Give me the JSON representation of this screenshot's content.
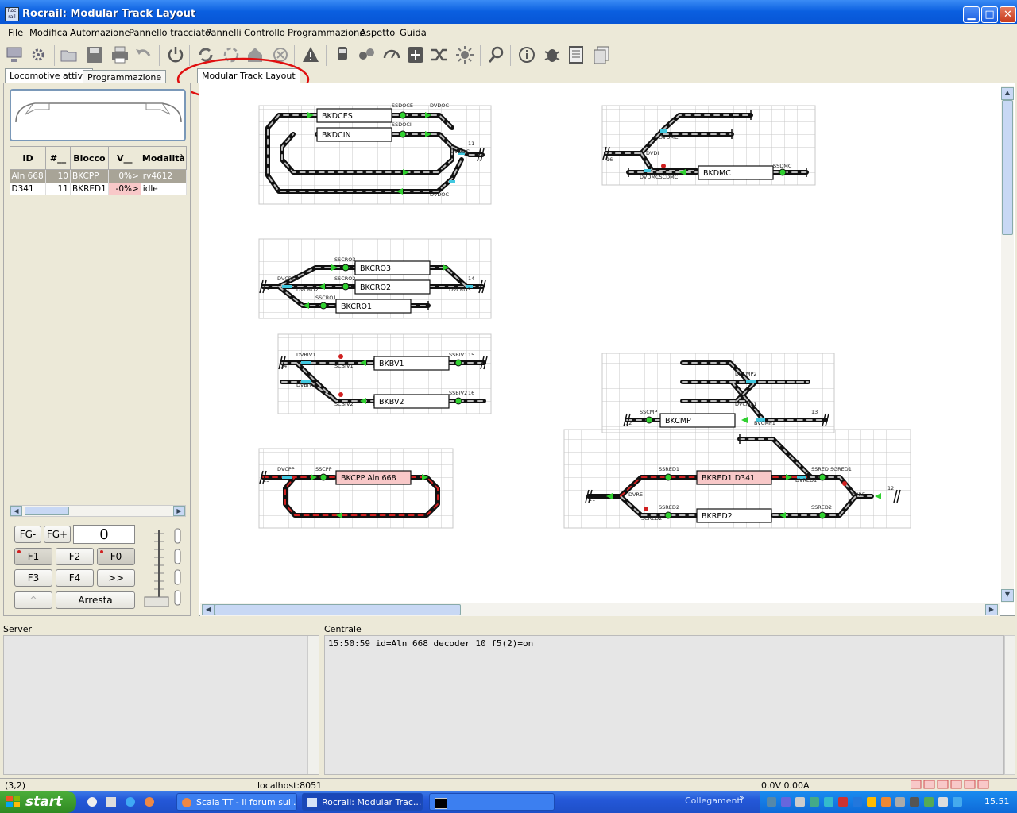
{
  "window": {
    "title": "Rocrail: Modular Track Layout",
    "icon_label": "Roc rail"
  },
  "menu": [
    "File",
    "Modifica",
    "Automazione",
    "Pannello tracciato",
    "Pannelli",
    "Controllo",
    "Programmazione",
    "Aspetto",
    "Guida"
  ],
  "toolbar_icons": [
    "network-icon",
    "gear-icon",
    "folder-open-icon",
    "save-icon",
    "print-icon",
    "undo-icon",
    "power-icon",
    "refresh-icon",
    "cycle-icon",
    "house-icon",
    "cancel-icon",
    "warning-icon",
    "locomotive-icon",
    "railcar-icon",
    "speedometer-icon",
    "switchbox-icon",
    "shuffle-icon",
    "light-icon",
    "zoom-icon",
    "info-icon",
    "bug-icon",
    "document-icon",
    "copy-icon"
  ],
  "left_tabs": [
    "Locomotive attive",
    "Programmazione"
  ],
  "plan_tab": "Modular Track Layout",
  "loco_table": {
    "headers": [
      "ID",
      "#__",
      "Blocco",
      "V__",
      "Modalità"
    ],
    "rows": [
      {
        "id": "Aln 668",
        "addr": "10",
        "block": "BKCPP",
        "speed": "0%>",
        "mode": "rv4612"
      },
      {
        "id": "D341",
        "addr": "11",
        "block": "BKRED1",
        "speed": "-0%>",
        "mode": "idle"
      }
    ]
  },
  "throttle": {
    "fg_minus": "FG-",
    "fg_plus": "FG+",
    "speed": "0",
    "f1": "F1",
    "f2": "F2",
    "f0": "F0",
    "f3": "F3",
    "f4": "F4",
    "more": ">>",
    "up": "^",
    "stop": "Arresta"
  },
  "plan": {
    "blocks": [
      {
        "label": "BKDCES",
        "state": "free"
      },
      {
        "label": "BKDCIN",
        "state": "free"
      },
      {
        "label": "BKDMC",
        "state": "free"
      },
      {
        "label": "BKCRO3",
        "state": "free"
      },
      {
        "label": "BKCRO2",
        "state": "free"
      },
      {
        "label": "BKCRO1",
        "state": "free"
      },
      {
        "label": "BKBV1",
        "state": "free"
      },
      {
        "label": "BKBV2",
        "state": "free"
      },
      {
        "label": "BKCMP",
        "state": "free"
      },
      {
        "label": "BKCPP Aln 668",
        "state": "occupied"
      },
      {
        "label": "BKRED1 D341",
        "state": "occupied"
      },
      {
        "label": "BKRED2",
        "state": "free"
      }
    ],
    "labels": [
      "SSDOCE",
      "SSDOCI",
      "DVDOC",
      "DVDOC",
      "DVDOC",
      "11",
      "DVDMC",
      "DVDI",
      "16",
      "DVDMCSCDMC",
      "SSDMC",
      "SSCRO3",
      "SSCRO2",
      "SSCRO1",
      "DVCRO1",
      "DVCRO2",
      "DVCRO3",
      "13",
      "14",
      "DVBIV1",
      "DVBIV2",
      "SCBIV1",
      "SCBIV2",
      "SSBIV1",
      "SSBIV2",
      "14",
      "15",
      "16",
      "DVCPP",
      "SSCPP",
      "15",
      "DVCMP2",
      "DVCMP1",
      "SSCMP",
      "BVCMP1",
      "12",
      "13",
      "SSRED1",
      "SSRED2",
      "SSRED",
      "SGRED1",
      "DVRED1",
      "DVRE",
      "DVRE",
      "SCRED2",
      "SSRED2",
      "11",
      "12"
    ]
  },
  "panes": {
    "server_label": "Server",
    "central_label": "Centrale",
    "log": "15:50:59 id=Aln 668 decoder 10 f5(2)=on"
  },
  "status": {
    "coords": "(3,2)",
    "host": "localhost:8051",
    "power": "0.0V 0.00A"
  },
  "taskbar": {
    "start": "start",
    "tasks": [
      "Scala TT - il forum sull...",
      "Rocrail: Modular Trac...",
      ""
    ],
    "links": "Collegamenti",
    "clock": "15.51"
  },
  "colors": {
    "accent": "#0a5fe0",
    "occupied_block": "#f8c8c8",
    "route_red": "#d02020",
    "signal_green": "#30d030",
    "switch_cyan": "#40c8e0",
    "highlight_circle": "#e01010"
  }
}
